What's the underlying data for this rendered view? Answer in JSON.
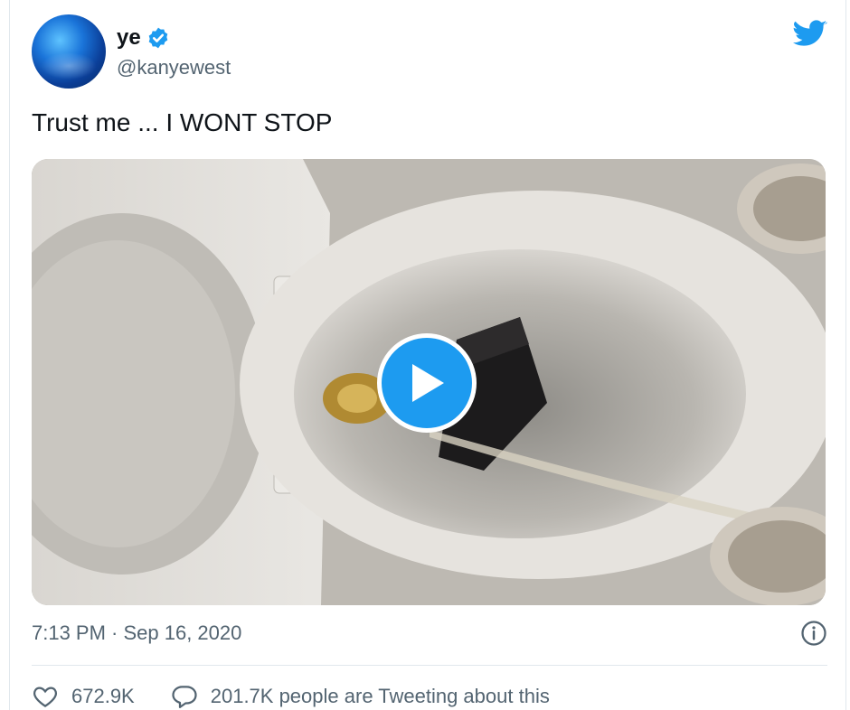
{
  "user": {
    "display_name": "ye",
    "handle": "@kanyewest",
    "verified": true,
    "avatar": "avatar-blue-sphere"
  },
  "tweet": {
    "text": "Trust me ... I WONT STOP",
    "media_type": "video",
    "timestamp": "7:13 PM · Sep 16, 2020"
  },
  "actions": {
    "like_count": "672.9K",
    "reply_text": "201.7K people are Tweeting about this"
  },
  "icons": {
    "brand": "twitter-bird-icon",
    "verified": "verified-badge-icon",
    "play": "play-icon",
    "info": "info-icon",
    "like": "heart-icon",
    "reply": "reply-bubble-icon"
  },
  "colors": {
    "accent": "#1d9bf0",
    "text": "#0f1419",
    "secondary": "#536471",
    "divider": "#e1e8ed"
  }
}
